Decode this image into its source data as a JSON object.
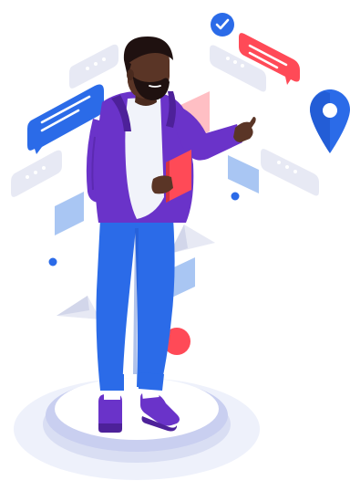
{
  "illustration": {
    "subject": "person-with-tablet",
    "icons": [
      "checkmark-icon",
      "location-pin-icon",
      "paper-plane-icon"
    ],
    "colors": {
      "platform_light": "#eef1fb",
      "platform_mid": "#d9def3",
      "platform_rim": "#c9cff0",
      "purple": "#6a33c9",
      "purple_dark": "#4d2199",
      "blue": "#2b6be8",
      "blue_dark": "#1c4fc4",
      "red": "#ff4a57",
      "red_light": "#ff8a94",
      "light_blue": "#a9c6f3",
      "grey_bubble": "#e7e9f4",
      "skin": "#5a3526",
      "beard": "#1f1110",
      "white": "#ffffff"
    }
  }
}
